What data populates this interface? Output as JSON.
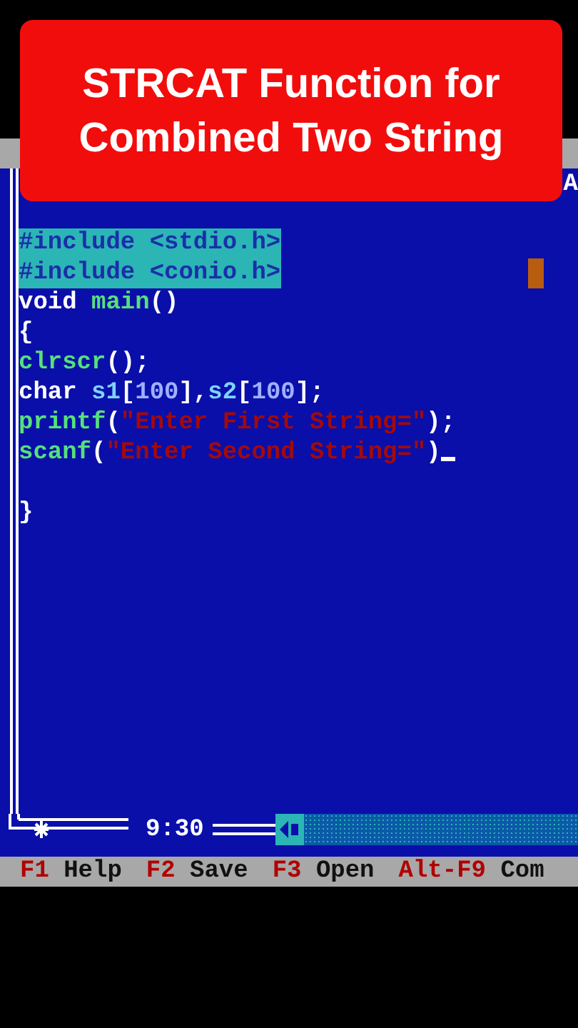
{
  "banner": {
    "title_lines": [
      "STRCAT Function for",
      "Combined Two String"
    ]
  },
  "editor": {
    "title_fragment": "A",
    "lines": [
      {
        "kind": "code",
        "selected": true,
        "tokens": [
          {
            "kind": "plain",
            "text": "#include <stdio.h>"
          }
        ]
      },
      {
        "kind": "code",
        "selected": true,
        "tokens": [
          {
            "kind": "plain",
            "text": "#include <conio.h>"
          }
        ]
      },
      {
        "kind": "code",
        "selected": false,
        "tokens": [
          {
            "kind": "plain",
            "text": "void "
          },
          {
            "kind": "func",
            "text": "main"
          },
          {
            "kind": "plain",
            "text": "()"
          }
        ]
      },
      {
        "kind": "code",
        "selected": false,
        "tokens": [
          {
            "kind": "plain",
            "text": "{"
          }
        ]
      },
      {
        "kind": "code",
        "selected": false,
        "tokens": [
          {
            "kind": "func",
            "text": "clrscr"
          },
          {
            "kind": "plain",
            "text": "();"
          }
        ]
      },
      {
        "kind": "code",
        "selected": false,
        "tokens": [
          {
            "kind": "plain",
            "text": "char "
          },
          {
            "kind": "ident",
            "text": "s1"
          },
          {
            "kind": "plain",
            "text": "["
          },
          {
            "kind": "number",
            "text": "100"
          },
          {
            "kind": "plain",
            "text": "],"
          },
          {
            "kind": "ident",
            "text": "s2"
          },
          {
            "kind": "plain",
            "text": "["
          },
          {
            "kind": "number",
            "text": "100"
          },
          {
            "kind": "plain",
            "text": "];"
          }
        ]
      },
      {
        "kind": "code",
        "selected": false,
        "tokens": [
          {
            "kind": "func",
            "text": "printf"
          },
          {
            "kind": "plain",
            "text": "("
          },
          {
            "kind": "string",
            "text": "\"Enter First String=\""
          },
          {
            "kind": "plain",
            "text": ");"
          }
        ]
      },
      {
        "kind": "code",
        "selected": false,
        "cursor": true,
        "tokens": [
          {
            "kind": "func",
            "text": "scanf"
          },
          {
            "kind": "plain",
            "text": "("
          },
          {
            "kind": "string",
            "text": "\"Enter Second String=\""
          },
          {
            "kind": "plain",
            "text": ")"
          }
        ]
      },
      {
        "kind": "blank"
      },
      {
        "kind": "code",
        "selected": false,
        "tokens": [
          {
            "kind": "plain",
            "text": "}"
          }
        ]
      }
    ],
    "position": "9:30"
  },
  "status_bar": [
    {
      "key": "F1",
      "label": "Help"
    },
    {
      "key": "F2",
      "label": "Save"
    },
    {
      "key": "F3",
      "label": "Open"
    },
    {
      "key": "Alt-F9",
      "label": "Com"
    }
  ]
}
